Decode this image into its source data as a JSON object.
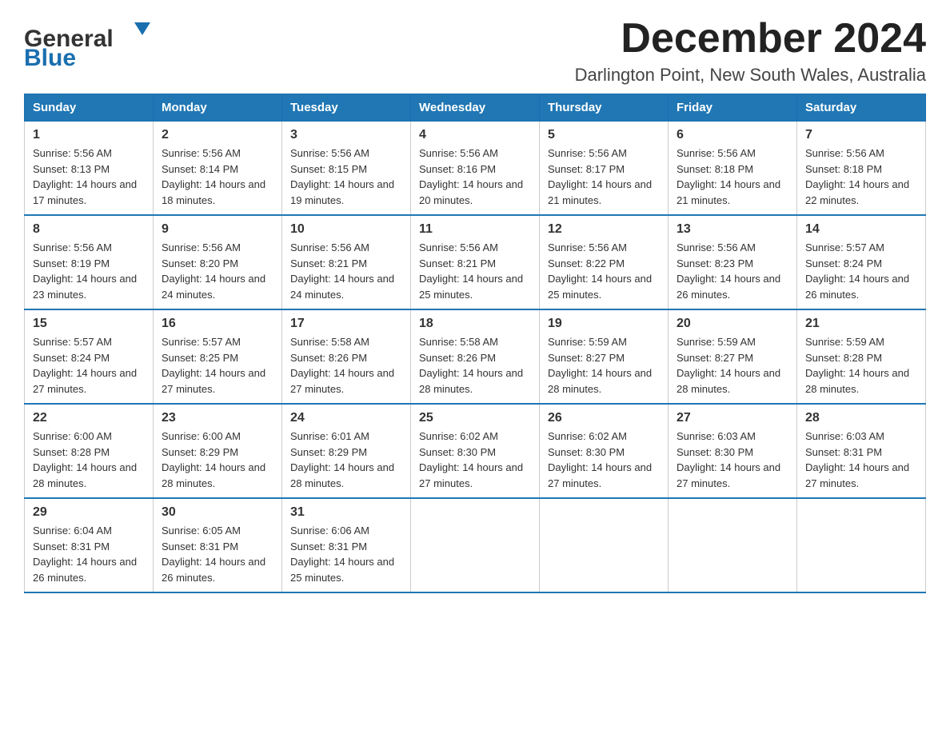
{
  "header": {
    "logo": {
      "general": "General",
      "blue": "Blue",
      "arrow": "▼"
    },
    "title": "December 2024",
    "location": "Darlington Point, New South Wales, Australia"
  },
  "weekdays": [
    "Sunday",
    "Monday",
    "Tuesday",
    "Wednesday",
    "Thursday",
    "Friday",
    "Saturday"
  ],
  "weeks": [
    [
      {
        "day": "1",
        "sunrise": "Sunrise: 5:56 AM",
        "sunset": "Sunset: 8:13 PM",
        "daylight": "Daylight: 14 hours and 17 minutes."
      },
      {
        "day": "2",
        "sunrise": "Sunrise: 5:56 AM",
        "sunset": "Sunset: 8:14 PM",
        "daylight": "Daylight: 14 hours and 18 minutes."
      },
      {
        "day": "3",
        "sunrise": "Sunrise: 5:56 AM",
        "sunset": "Sunset: 8:15 PM",
        "daylight": "Daylight: 14 hours and 19 minutes."
      },
      {
        "day": "4",
        "sunrise": "Sunrise: 5:56 AM",
        "sunset": "Sunset: 8:16 PM",
        "daylight": "Daylight: 14 hours and 20 minutes."
      },
      {
        "day": "5",
        "sunrise": "Sunrise: 5:56 AM",
        "sunset": "Sunset: 8:17 PM",
        "daylight": "Daylight: 14 hours and 21 minutes."
      },
      {
        "day": "6",
        "sunrise": "Sunrise: 5:56 AM",
        "sunset": "Sunset: 8:18 PM",
        "daylight": "Daylight: 14 hours and 21 minutes."
      },
      {
        "day": "7",
        "sunrise": "Sunrise: 5:56 AM",
        "sunset": "Sunset: 8:18 PM",
        "daylight": "Daylight: 14 hours and 22 minutes."
      }
    ],
    [
      {
        "day": "8",
        "sunrise": "Sunrise: 5:56 AM",
        "sunset": "Sunset: 8:19 PM",
        "daylight": "Daylight: 14 hours and 23 minutes."
      },
      {
        "day": "9",
        "sunrise": "Sunrise: 5:56 AM",
        "sunset": "Sunset: 8:20 PM",
        "daylight": "Daylight: 14 hours and 24 minutes."
      },
      {
        "day": "10",
        "sunrise": "Sunrise: 5:56 AM",
        "sunset": "Sunset: 8:21 PM",
        "daylight": "Daylight: 14 hours and 24 minutes."
      },
      {
        "day": "11",
        "sunrise": "Sunrise: 5:56 AM",
        "sunset": "Sunset: 8:21 PM",
        "daylight": "Daylight: 14 hours and 25 minutes."
      },
      {
        "day": "12",
        "sunrise": "Sunrise: 5:56 AM",
        "sunset": "Sunset: 8:22 PM",
        "daylight": "Daylight: 14 hours and 25 minutes."
      },
      {
        "day": "13",
        "sunrise": "Sunrise: 5:56 AM",
        "sunset": "Sunset: 8:23 PM",
        "daylight": "Daylight: 14 hours and 26 minutes."
      },
      {
        "day": "14",
        "sunrise": "Sunrise: 5:57 AM",
        "sunset": "Sunset: 8:24 PM",
        "daylight": "Daylight: 14 hours and 26 minutes."
      }
    ],
    [
      {
        "day": "15",
        "sunrise": "Sunrise: 5:57 AM",
        "sunset": "Sunset: 8:24 PM",
        "daylight": "Daylight: 14 hours and 27 minutes."
      },
      {
        "day": "16",
        "sunrise": "Sunrise: 5:57 AM",
        "sunset": "Sunset: 8:25 PM",
        "daylight": "Daylight: 14 hours and 27 minutes."
      },
      {
        "day": "17",
        "sunrise": "Sunrise: 5:58 AM",
        "sunset": "Sunset: 8:26 PM",
        "daylight": "Daylight: 14 hours and 27 minutes."
      },
      {
        "day": "18",
        "sunrise": "Sunrise: 5:58 AM",
        "sunset": "Sunset: 8:26 PM",
        "daylight": "Daylight: 14 hours and 28 minutes."
      },
      {
        "day": "19",
        "sunrise": "Sunrise: 5:59 AM",
        "sunset": "Sunset: 8:27 PM",
        "daylight": "Daylight: 14 hours and 28 minutes."
      },
      {
        "day": "20",
        "sunrise": "Sunrise: 5:59 AM",
        "sunset": "Sunset: 8:27 PM",
        "daylight": "Daylight: 14 hours and 28 minutes."
      },
      {
        "day": "21",
        "sunrise": "Sunrise: 5:59 AM",
        "sunset": "Sunset: 8:28 PM",
        "daylight": "Daylight: 14 hours and 28 minutes."
      }
    ],
    [
      {
        "day": "22",
        "sunrise": "Sunrise: 6:00 AM",
        "sunset": "Sunset: 8:28 PM",
        "daylight": "Daylight: 14 hours and 28 minutes."
      },
      {
        "day": "23",
        "sunrise": "Sunrise: 6:00 AM",
        "sunset": "Sunset: 8:29 PM",
        "daylight": "Daylight: 14 hours and 28 minutes."
      },
      {
        "day": "24",
        "sunrise": "Sunrise: 6:01 AM",
        "sunset": "Sunset: 8:29 PM",
        "daylight": "Daylight: 14 hours and 28 minutes."
      },
      {
        "day": "25",
        "sunrise": "Sunrise: 6:02 AM",
        "sunset": "Sunset: 8:30 PM",
        "daylight": "Daylight: 14 hours and 27 minutes."
      },
      {
        "day": "26",
        "sunrise": "Sunrise: 6:02 AM",
        "sunset": "Sunset: 8:30 PM",
        "daylight": "Daylight: 14 hours and 27 minutes."
      },
      {
        "day": "27",
        "sunrise": "Sunrise: 6:03 AM",
        "sunset": "Sunset: 8:30 PM",
        "daylight": "Daylight: 14 hours and 27 minutes."
      },
      {
        "day": "28",
        "sunrise": "Sunrise: 6:03 AM",
        "sunset": "Sunset: 8:31 PM",
        "daylight": "Daylight: 14 hours and 27 minutes."
      }
    ],
    [
      {
        "day": "29",
        "sunrise": "Sunrise: 6:04 AM",
        "sunset": "Sunset: 8:31 PM",
        "daylight": "Daylight: 14 hours and 26 minutes."
      },
      {
        "day": "30",
        "sunrise": "Sunrise: 6:05 AM",
        "sunset": "Sunset: 8:31 PM",
        "daylight": "Daylight: 14 hours and 26 minutes."
      },
      {
        "day": "31",
        "sunrise": "Sunrise: 6:06 AM",
        "sunset": "Sunset: 8:31 PM",
        "daylight": "Daylight: 14 hours and 25 minutes."
      },
      null,
      null,
      null,
      null
    ]
  ]
}
